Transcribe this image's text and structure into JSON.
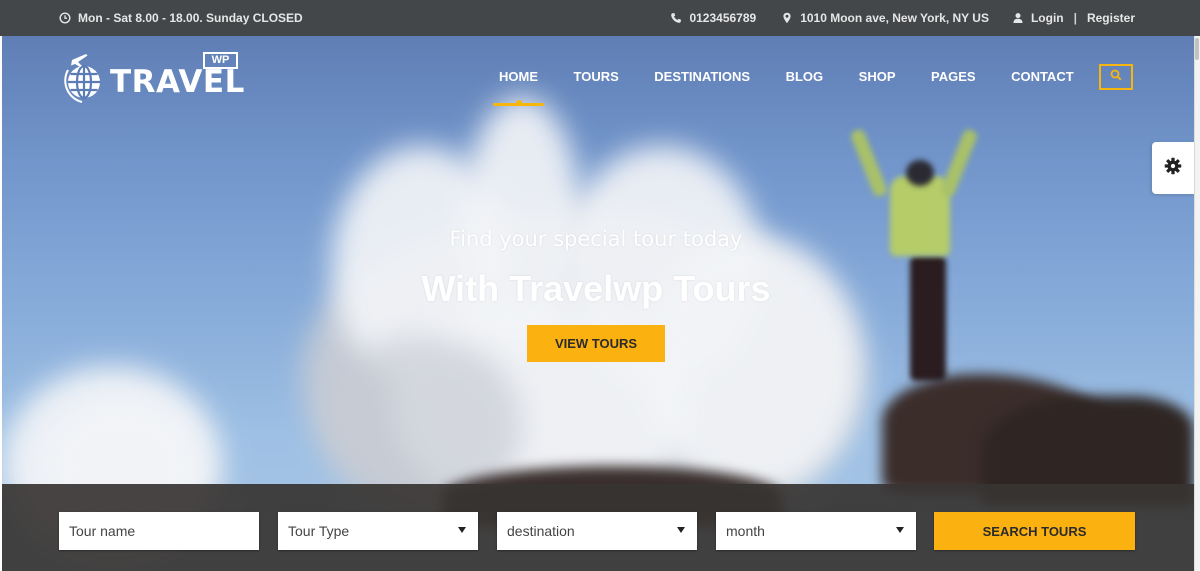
{
  "topbar": {
    "hours": "Mon - Sat 8.00 - 18.00. Sunday CLOSED",
    "phone": "0123456789",
    "address": "1010 Moon ave, New York, NY US",
    "login": "Login",
    "separator": "|",
    "register": "Register"
  },
  "logo": {
    "text": "TRAVEL",
    "badge": "WP"
  },
  "nav": {
    "items": [
      {
        "label": "HOME",
        "active": true
      },
      {
        "label": "TOURS"
      },
      {
        "label": "DESTINATIONS"
      },
      {
        "label": "BLOG"
      },
      {
        "label": "SHOP"
      },
      {
        "label": "PAGES"
      },
      {
        "label": "CONTACT"
      }
    ]
  },
  "hero": {
    "subtitle": "Find your special tour today",
    "title": "With Travelwp Tours",
    "button": "VIEW TOURS"
  },
  "search": {
    "tour_name_placeholder": "Tour name",
    "tour_type": "Tour Type",
    "destination": "destination",
    "month": "month",
    "button": "SEARCH TOURS"
  },
  "colors": {
    "accent": "#fbb10f",
    "topbar": "#43474a",
    "searchbar": "#373432"
  }
}
